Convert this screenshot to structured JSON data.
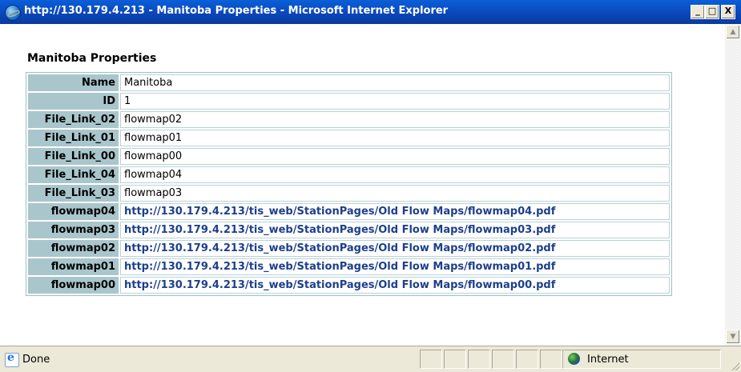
{
  "window": {
    "title": "http://130.179.4.213 - Manitoba Properties - Microsoft Internet Explorer",
    "minimize": "_",
    "maximize": "□",
    "close": "X"
  },
  "page": {
    "heading": "Manitoba Properties",
    "rows": [
      {
        "key": "Name",
        "value": "Manitoba",
        "link": false
      },
      {
        "key": "ID",
        "value": "1",
        "link": false
      },
      {
        "key": "File_Link_02",
        "value": "flowmap02",
        "link": false
      },
      {
        "key": "File_Link_01",
        "value": "flowmap01",
        "link": false
      },
      {
        "key": "File_Link_00",
        "value": "flowmap00",
        "link": false
      },
      {
        "key": "File_Link_04",
        "value": "flowmap04",
        "link": false
      },
      {
        "key": "File_Link_03",
        "value": "flowmap03",
        "link": false
      },
      {
        "key": "flowmap04",
        "value": "http://130.179.4.213/tis_web/StationPages/Old Flow Maps/flowmap04.pdf",
        "link": true
      },
      {
        "key": "flowmap03",
        "value": "http://130.179.4.213/tis_web/StationPages/Old Flow Maps/flowmap03.pdf",
        "link": true
      },
      {
        "key": "flowmap02",
        "value": "http://130.179.4.213/tis_web/StationPages/Old Flow Maps/flowmap02.pdf",
        "link": true
      },
      {
        "key": "flowmap01",
        "value": "http://130.179.4.213/tis_web/StationPages/Old Flow Maps/flowmap01.pdf",
        "link": true
      },
      {
        "key": "flowmap00",
        "value": "http://130.179.4.213/tis_web/StationPages/Old Flow Maps/flowmap00.pdf",
        "link": true
      }
    ]
  },
  "status": {
    "text": "Done",
    "zone": "Internet"
  },
  "colors": {
    "titlebar": "#0b45b8",
    "key_cell": "#a9c6cc",
    "link": "#1d3f8c"
  }
}
